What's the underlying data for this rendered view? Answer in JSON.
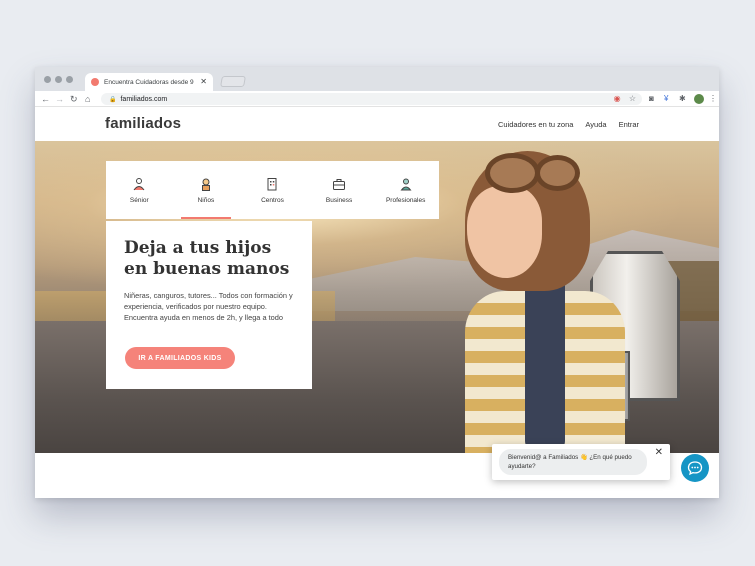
{
  "browser": {
    "tab_title": "Encuentra Cuidadoras desde 9",
    "tab_close": "✕",
    "url": "familiados.com"
  },
  "site": {
    "logo": "familiados",
    "nav": [
      "Cuidadores en tu zona",
      "Ayuda",
      "Entrar"
    ]
  },
  "categories": [
    {
      "label": "Sénior",
      "icon": "senior-icon",
      "active": false
    },
    {
      "label": "Niños",
      "icon": "child-icon",
      "active": true
    },
    {
      "label": "Centros",
      "icon": "building-icon",
      "active": false
    },
    {
      "label": "Business",
      "icon": "briefcase-icon",
      "active": false
    },
    {
      "label": "Profesionales",
      "icon": "professional-icon",
      "active": false
    }
  ],
  "hero": {
    "title": "Deja a tus hijos en buenas manos",
    "description": "Niñeras, canguros, tutores... Todos con formación y experiencia, verificados por nuestro equipo. Encuentra ayuda en menos de 2h, y llega a todo",
    "cta": "IR A FAMILIADOS KIDS"
  },
  "chat": {
    "message": "Bienvenid@ a Familiados 👋 ¿En qué puedo ayudarte?",
    "close": "✕"
  },
  "colors": {
    "accent": "#f27a6f",
    "chat": "#1595c5",
    "text": "#333333"
  }
}
